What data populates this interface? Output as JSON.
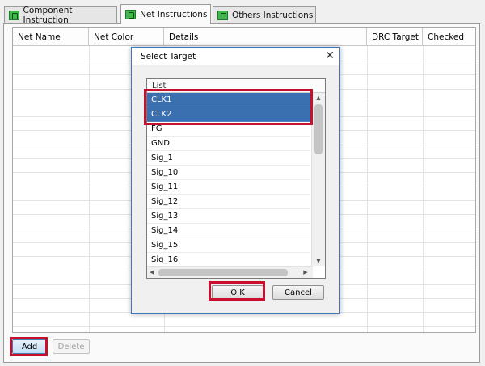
{
  "tabs": [
    {
      "label": "Component Instruction"
    },
    {
      "label": "Net Instructions"
    },
    {
      "label": "Others Instructions"
    }
  ],
  "table": {
    "columns": [
      "Net Name",
      "Net Color",
      "Details",
      "DRC Target",
      "Checked"
    ]
  },
  "buttons": {
    "add": "Add",
    "delete": "Delete"
  },
  "dialog": {
    "title": "Select Target",
    "close": "✕",
    "list_header": "List",
    "items": [
      "CLK1",
      "CLK2",
      "FG",
      "GND",
      "Sig_1",
      "Sig_10",
      "Sig_11",
      "Sig_12",
      "Sig_13",
      "Sig_14",
      "Sig_15",
      "Sig_16"
    ],
    "selected": [
      "CLK1",
      "CLK2"
    ],
    "ok": "O K",
    "cancel": "Cancel"
  },
  "colors": {
    "selection": "#3a6fb0",
    "highlight": "#c8102e",
    "tab_icon": "#3fb94a"
  },
  "icons": [
    "tab-component-icon",
    "tab-net-icon",
    "tab-others-icon",
    "close-icon",
    "scroll-up-icon",
    "scroll-down-icon",
    "scroll-left-icon",
    "scroll-right-icon"
  ]
}
